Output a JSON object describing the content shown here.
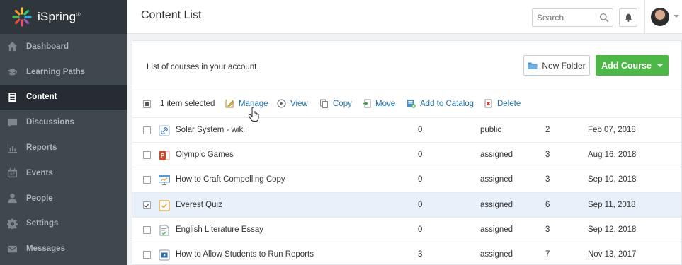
{
  "brand": {
    "name": "iSpring",
    "mark": "®"
  },
  "sidebar": {
    "items": [
      {
        "label": "Dashboard",
        "icon": "home-icon",
        "active": false
      },
      {
        "label": "Learning Paths",
        "icon": "graduation-cap-icon",
        "active": false
      },
      {
        "label": "Content",
        "icon": "content-icon",
        "active": true
      },
      {
        "label": "Discussions",
        "icon": "chat-icon",
        "active": false
      },
      {
        "label": "Reports",
        "icon": "bar-chart-icon",
        "active": false
      },
      {
        "label": "Events",
        "icon": "calendar-icon",
        "active": false
      },
      {
        "label": "People",
        "icon": "person-icon",
        "active": false
      },
      {
        "label": "Settings",
        "icon": "gear-icon",
        "active": false
      },
      {
        "label": "Messages",
        "icon": "envelope-icon",
        "active": false
      }
    ]
  },
  "header": {
    "title": "Content List",
    "search_placeholder": "Search"
  },
  "main": {
    "description": "List of courses in your account",
    "new_folder_label": "New Folder",
    "add_course_label": "Add Course",
    "toolbar": {
      "selection_text": "1 item selected",
      "actions": [
        {
          "label": "Manage",
          "icon": "manage-icon"
        },
        {
          "label": "View",
          "icon": "play-circle-icon"
        },
        {
          "label": "Copy",
          "icon": "copy-icon"
        },
        {
          "label": "Move",
          "icon": "move-icon"
        },
        {
          "label": "Add to Catalog",
          "icon": "catalog-icon"
        },
        {
          "label": "Delete",
          "icon": "delete-icon"
        }
      ]
    },
    "rows": [
      {
        "checked": false,
        "icon": "link-icon",
        "name": "Solar System - wiki",
        "views": "0",
        "access": "public",
        "count": "2",
        "date": "Feb 07, 2018"
      },
      {
        "checked": false,
        "icon": "powerpoint-icon",
        "name": "Olympic Games",
        "views": "0",
        "access": "assigned",
        "count": "3",
        "date": "Aug 16, 2018"
      },
      {
        "checked": false,
        "icon": "presentation-icon",
        "name": "How to Craft Compelling Copy",
        "views": "0",
        "access": "assigned",
        "count": "3",
        "date": "Sep 10, 2018"
      },
      {
        "checked": true,
        "icon": "quiz-icon",
        "name": "Everest Quiz",
        "views": "0",
        "access": "assigned",
        "count": "6",
        "date": "Sep 11, 2018"
      },
      {
        "checked": false,
        "icon": "essay-icon",
        "name": "English Literature Essay",
        "views": "0",
        "access": "assigned",
        "count": "3",
        "date": "Sep 12, 2018"
      },
      {
        "checked": false,
        "icon": "video-icon",
        "name": "How to Allow Students to Run Reports",
        "views": "3",
        "access": "assigned",
        "count": "7",
        "date": "Nov 13, 2017"
      }
    ]
  },
  "colors": {
    "sidebar": "#3f474f",
    "sidebar_active": "#262c31",
    "accent_green": "#4db847",
    "link_blue": "#1f6fa8",
    "selected_row": "#e8f1fa"
  }
}
